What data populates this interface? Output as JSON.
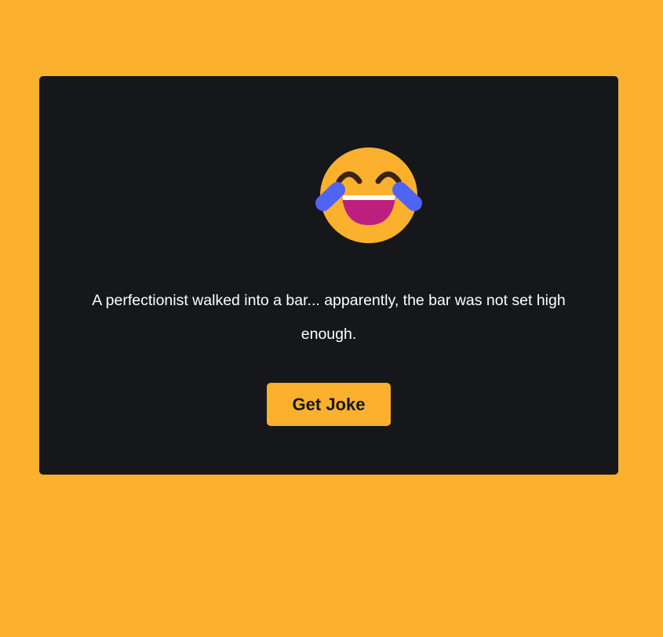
{
  "colors": {
    "page_background": "#fbb02e",
    "card_background": "#16171b",
    "joke_text": "#ffffff",
    "button_background": "#fbb02e",
    "button_text": "#16171b"
  },
  "emoji": {
    "icon": "face-with-tears-of-joy-icon"
  },
  "joke": {
    "text": "A perfectionist walked into a bar... apparently, the bar was not set high enough."
  },
  "button": {
    "label": "Get Joke"
  }
}
